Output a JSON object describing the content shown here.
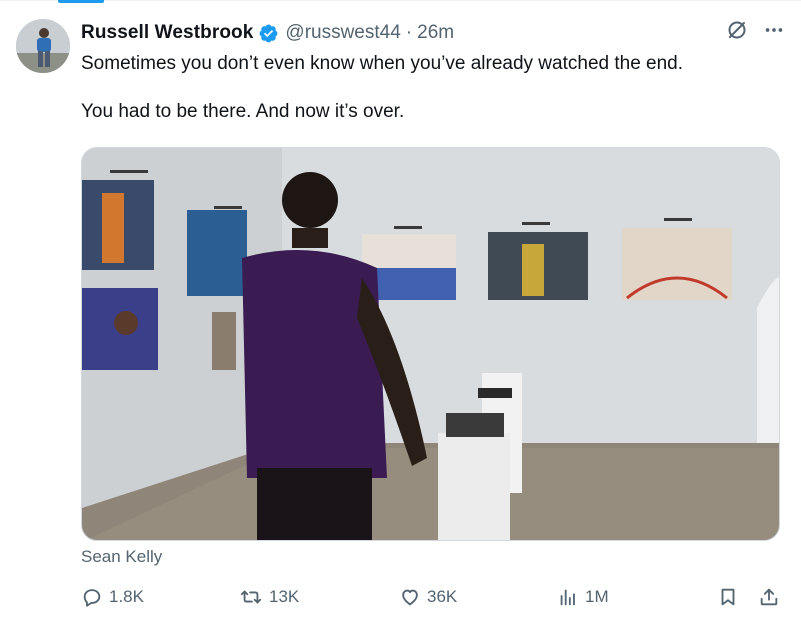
{
  "tweet": {
    "author_name": "Russell Westbrook",
    "handle": "@russwest44",
    "separator": "·",
    "time": "26m",
    "text": "Sometimes you don’t even know when you’ve already watched the end.\n\nYou had to be there. And now it’s over.",
    "media_credit": "Sean Kelly"
  },
  "actions": {
    "replies": "1.8K",
    "reposts": "13K",
    "likes": "36K",
    "views": "1M"
  },
  "colors": {
    "accent": "#1d9bf0",
    "muted": "#536471",
    "text": "#0f1419"
  },
  "icons": [
    "verified-badge-icon",
    "grok-icon",
    "more-icon",
    "reply-icon",
    "repost-icon",
    "like-icon",
    "views-icon",
    "bookmark-icon",
    "share-icon"
  ]
}
